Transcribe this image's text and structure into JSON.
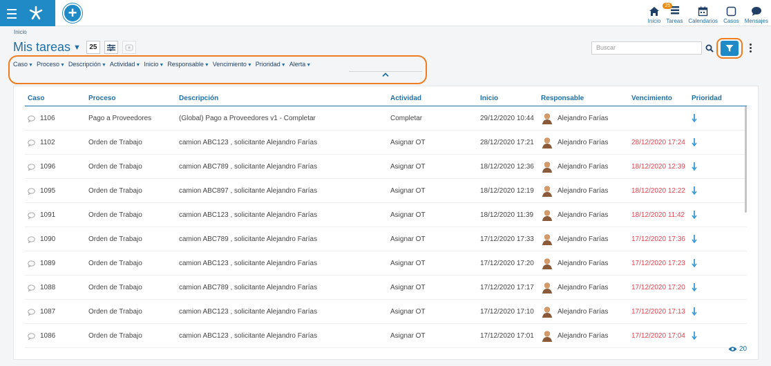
{
  "topbar": {
    "nav": [
      {
        "label": "Inicio",
        "icon": "home-icon"
      },
      {
        "label": "Tareas",
        "icon": "tasks-icon",
        "badge": "25"
      },
      {
        "label": "Calendarios",
        "icon": "calendar-icon"
      },
      {
        "label": "Casos",
        "icon": "cases-icon"
      },
      {
        "label": "Mensajes",
        "icon": "messages-icon"
      }
    ]
  },
  "breadcrumb": "Inicio",
  "page": {
    "title": "Mis tareas",
    "count": "25"
  },
  "search": {
    "placeholder": "Buscar"
  },
  "filters": [
    "Caso",
    "Proceso",
    "Descripción",
    "Actividad",
    "Inicio",
    "Responsable",
    "Vencimiento",
    "Prioridad",
    "Alerta"
  ],
  "grid": {
    "columns": [
      "Caso",
      "Proceso",
      "Descripción",
      "Actividad",
      "Inicio",
      "Responsable",
      "Vencimiento",
      "Prioridad"
    ],
    "rows": [
      {
        "caso": "1106",
        "proceso": "Pago a Proveedores",
        "descripcion": "(Global) Pago a Proveedores v1 - Completar",
        "actividad": "Completar",
        "inicio": "29/12/2020 10:44",
        "responsable": "Alejandro Farías",
        "vencimiento": ""
      },
      {
        "caso": "1102",
        "proceso": "Orden de Trabajo",
        "descripcion": "camion ABC123 , solicitante Alejandro Farías",
        "actividad": "Asignar OT",
        "inicio": "28/12/2020 17:21",
        "responsable": "Alejandro Farías",
        "vencimiento": "28/12/2020 17:24"
      },
      {
        "caso": "1096",
        "proceso": "Orden de Trabajo",
        "descripcion": "camion ABC789 , solicitante Alejandro Farías",
        "actividad": "Asignar OT",
        "inicio": "18/12/2020 12:36",
        "responsable": "Alejandro Farías",
        "vencimiento": "18/12/2020 12:39"
      },
      {
        "caso": "1095",
        "proceso": "Orden de Trabajo",
        "descripcion": "camion ABC897 , solicitante Alejandro Farías",
        "actividad": "Asignar OT",
        "inicio": "18/12/2020 12:19",
        "responsable": "Alejandro Farías",
        "vencimiento": "18/12/2020 12:22"
      },
      {
        "caso": "1091",
        "proceso": "Orden de Trabajo",
        "descripcion": "camion ABC123 , solicitante Alejandro Farías",
        "actividad": "Asignar OT",
        "inicio": "18/12/2020 11:39",
        "responsable": "Alejandro Farías",
        "vencimiento": "18/12/2020 11:42"
      },
      {
        "caso": "1090",
        "proceso": "Orden de Trabajo",
        "descripcion": "camion ABC789 , solicitante Alejandro Farías",
        "actividad": "Asignar OT",
        "inicio": "17/12/2020 17:33",
        "responsable": "Alejandro Farías",
        "vencimiento": "17/12/2020 17:36"
      },
      {
        "caso": "1089",
        "proceso": "Orden de Trabajo",
        "descripcion": "camion ABC123 , solicitante Alejandro Farías",
        "actividad": "Asignar OT",
        "inicio": "17/12/2020 17:20",
        "responsable": "Alejandro Farías",
        "vencimiento": "17/12/2020 17:23"
      },
      {
        "caso": "1088",
        "proceso": "Orden de Trabajo",
        "descripcion": "camion ABC789 , solicitante Alejandro Farías",
        "actividad": "Asignar OT",
        "inicio": "17/12/2020 17:17",
        "responsable": "Alejandro Farías",
        "vencimiento": "17/12/2020 17:20"
      },
      {
        "caso": "1087",
        "proceso": "Orden de Trabajo",
        "descripcion": "camion ABC123 , solicitante Alejandro Farías",
        "actividad": "Asignar OT",
        "inicio": "17/12/2020 17:10",
        "responsable": "Alejandro Farías",
        "vencimiento": "17/12/2020 17:13"
      },
      {
        "caso": "1086",
        "proceso": "Orden de Trabajo",
        "descripcion": "camion ABC123 , solicitante Alejandro Farías",
        "actividad": "Asignar OT",
        "inicio": "17/12/2020 17:01",
        "responsable": "Alejandro Farías",
        "vencimiento": "17/12/2020 17:04"
      }
    ]
  },
  "footer": {
    "visible_count": "20"
  },
  "colors": {
    "accent": "#1f8ac6",
    "highlight": "#ee7d22",
    "overdue": "#e2424f"
  }
}
